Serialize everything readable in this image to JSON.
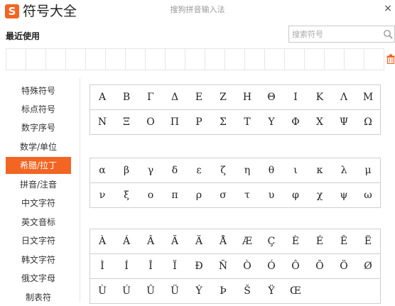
{
  "header": {
    "logo_letter": "S",
    "app_title": "符号大全",
    "window_title": "搜狗拼音输入法",
    "close_label": "×"
  },
  "recent": {
    "label": "最近使用",
    "cells": 19
  },
  "search": {
    "placeholder": "搜索符号",
    "value": ""
  },
  "sidebar": {
    "items": [
      {
        "label": "特殊符号",
        "active": false
      },
      {
        "label": "标点符号",
        "active": false
      },
      {
        "label": "数字序号",
        "active": false
      },
      {
        "label": "数学/单位",
        "active": false
      },
      {
        "label": "希腊/拉丁",
        "active": true
      },
      {
        "label": "拼音/注音",
        "active": false
      },
      {
        "label": "中文字符",
        "active": false
      },
      {
        "label": "英文音标",
        "active": false
      },
      {
        "label": "日文字符",
        "active": false
      },
      {
        "label": "韩文字符",
        "active": false
      },
      {
        "label": "俄文字母",
        "active": false
      },
      {
        "label": "制表符",
        "active": false
      }
    ]
  },
  "grids": [
    {
      "name": "greek-upper-grid",
      "rows": [
        [
          "Α",
          "Β",
          "Γ",
          "Δ",
          "Ε",
          "Ζ",
          "Η",
          "Θ",
          "Ι",
          "Κ",
          "Λ",
          "Μ"
        ],
        [
          "Ν",
          "Ξ",
          "Ο",
          "Π",
          "Ρ",
          "Σ",
          "Τ",
          "Υ",
          "Φ",
          "Χ",
          "Ψ",
          "Ω"
        ]
      ]
    },
    {
      "name": "greek-lower-grid",
      "rows": [
        [
          "α",
          "β",
          "γ",
          "δ",
          "ε",
          "ζ",
          "η",
          "θ",
          "ι",
          "κ",
          "λ",
          "μ"
        ],
        [
          "ν",
          "ξ",
          "ο",
          "π",
          "ρ",
          "σ",
          "τ",
          "υ",
          "φ",
          "χ",
          "ψ",
          "ω"
        ]
      ]
    },
    {
      "name": "latin-upper-grid",
      "rows": [
        [
          "À",
          "Á",
          "Â",
          "Ã",
          "Ä",
          "Å",
          "Æ",
          "Ç",
          "È",
          "É",
          "Ê",
          "Ë"
        ],
        [
          "Ì",
          "Í",
          "Î",
          "Ï",
          "Ð",
          "Ñ",
          "Ò",
          "Ó",
          "Ô",
          "Õ",
          "Ö",
          "Ø"
        ],
        [
          "Ù",
          "Ú",
          "Û",
          "Ü",
          "Ý",
          "Þ",
          "Š",
          "Ÿ",
          "Œ",
          "",
          "",
          ""
        ]
      ]
    }
  ],
  "colors": {
    "accent": "#f26522",
    "border": "#cfcfcf"
  },
  "icons": [
    "sogou-logo-icon",
    "close-icon",
    "search-icon",
    "trash-icon"
  ]
}
